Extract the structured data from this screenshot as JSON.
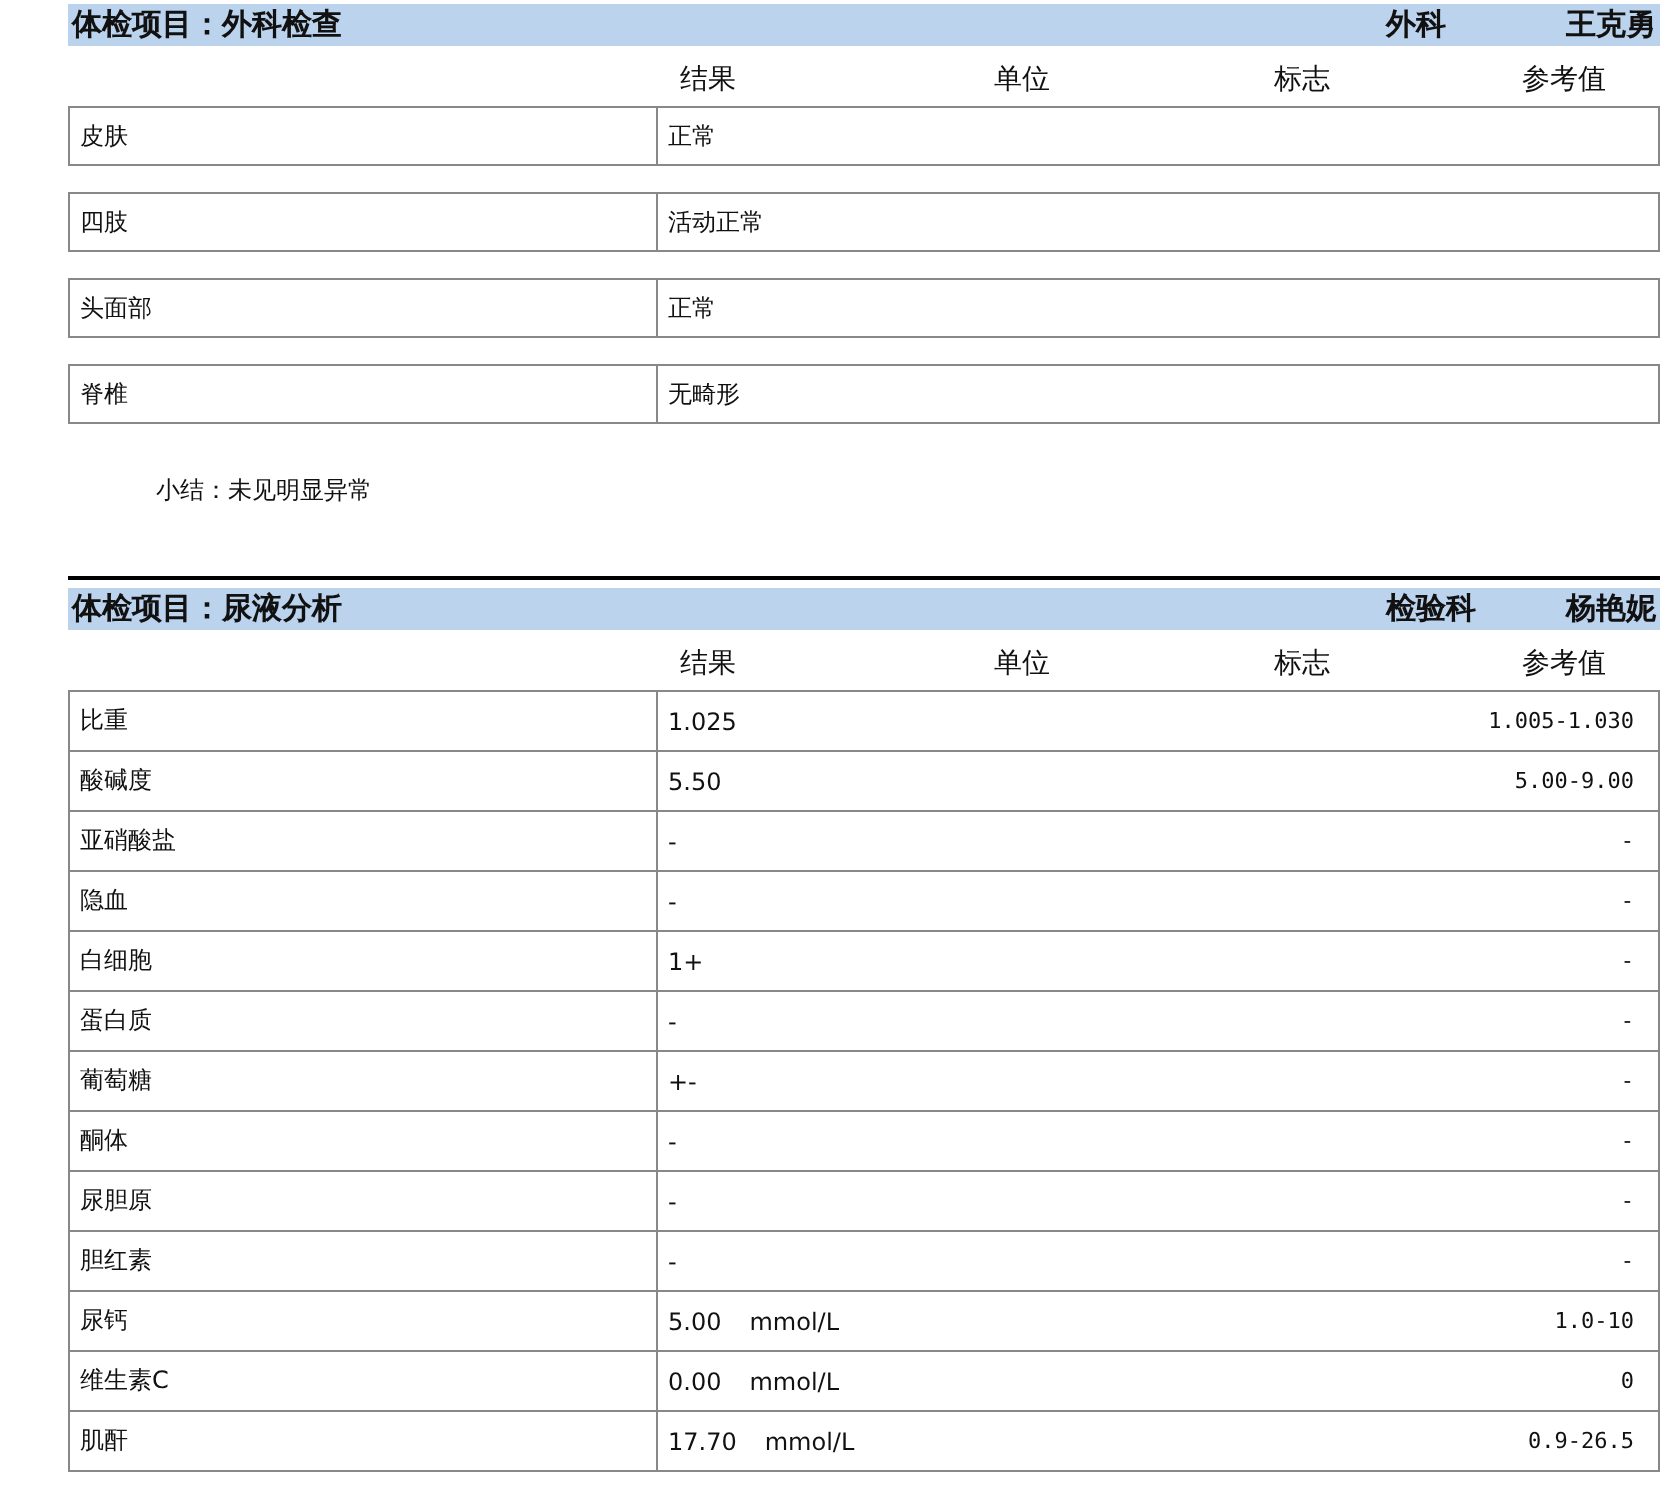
{
  "sections": [
    {
      "kind": "boxed",
      "title": "体检项目：外科检查",
      "department": "外科",
      "doctor": "王克勇",
      "columns": [
        "结果",
        "单位",
        "标志",
        "参考值"
      ],
      "rows": [
        {
          "name": "皮肤",
          "result": "正常"
        },
        {
          "name": "四肢",
          "result": "活动正常"
        },
        {
          "name": "头面部",
          "result": "正常"
        },
        {
          "name": "脊椎",
          "result": "无畸形"
        }
      ],
      "summary": "小结：未见明显异常"
    },
    {
      "kind": "grid",
      "title": "体检项目：尿液分析",
      "department": "检验科",
      "doctor": "杨艳妮",
      "columns": [
        "结果",
        "单位",
        "标志",
        "参考值"
      ],
      "rows": [
        {
          "name": "比重",
          "result": "1.025",
          "reference": "1.005-1.030"
        },
        {
          "name": "酸碱度",
          "result": "5.50",
          "reference": "5.00-9.00"
        },
        {
          "name": "亚硝酸盐",
          "result": "-",
          "reference": "-"
        },
        {
          "name": "隐血",
          "result": "-",
          "reference": "-"
        },
        {
          "name": "白细胞",
          "result": "1+",
          "reference": "-"
        },
        {
          "name": "蛋白质",
          "result": "-",
          "reference": "-"
        },
        {
          "name": "葡萄糖",
          "result": "+-",
          "reference": "-"
        },
        {
          "name": "酮体",
          "result": "-",
          "reference": "-"
        },
        {
          "name": "尿胆原",
          "result": "-",
          "reference": "-"
        },
        {
          "name": "胆红素",
          "result": "-",
          "reference": "-"
        },
        {
          "name": "尿钙",
          "result": "5.00",
          "unit": "mmol/L",
          "reference": "1.0-10"
        },
        {
          "name": "维生素C",
          "result": "0.00",
          "unit": "mmol/L",
          "reference": "0"
        },
        {
          "name": "肌酐",
          "result": "17.70",
          "unit": "mmol/L",
          "reference": "0.9-26.5"
        }
      ]
    }
  ]
}
